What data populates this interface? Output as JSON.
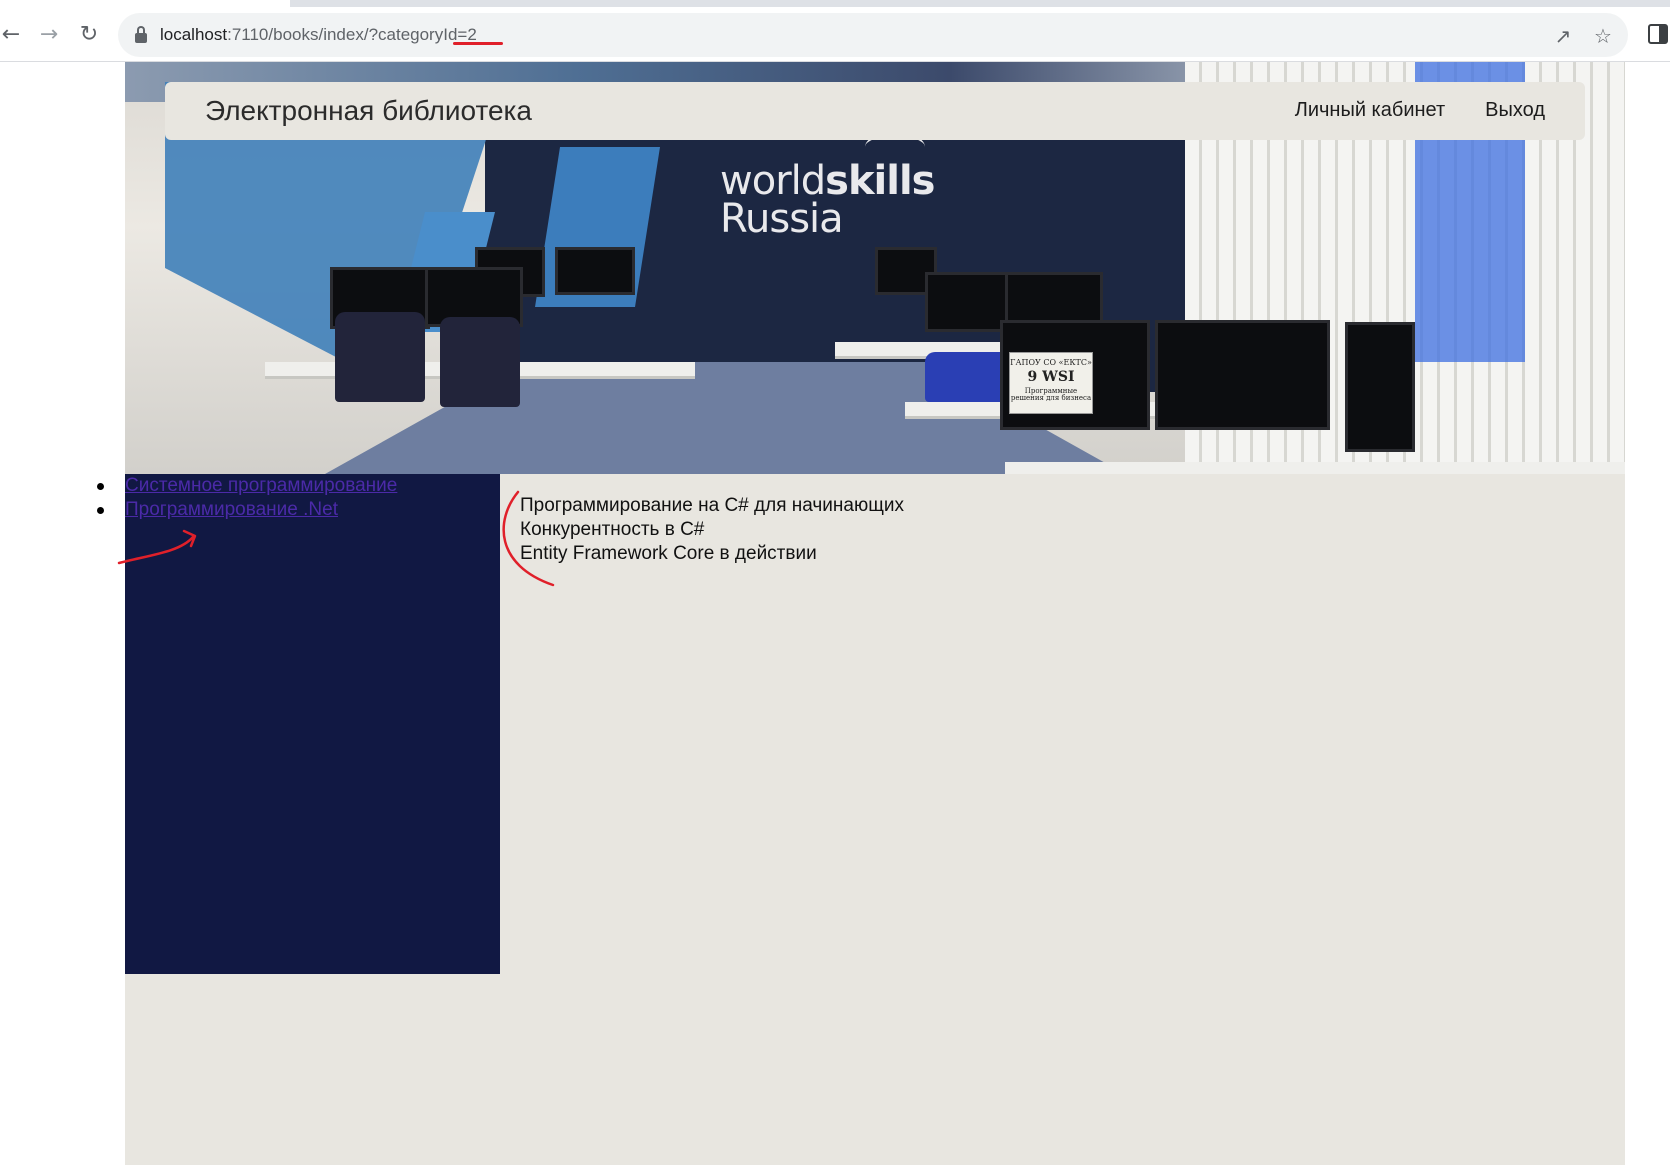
{
  "browser": {
    "url_host": "localhost",
    "url_rest": ":7110/books/index/?categoryId=2",
    "icons": {
      "back": "arrow-left-icon",
      "forward": "arrow-right-icon",
      "reload": "reload-icon",
      "lock": "lock-icon",
      "share": "share-icon",
      "bookmark": "star-icon",
      "side_panel": "side-panel-icon"
    }
  },
  "header": {
    "brand": "Электронная библиотека",
    "nav": [
      {
        "label": "Личный кабинет"
      },
      {
        "label": "Выход"
      }
    ]
  },
  "hero": {
    "logo_line1_a": "world",
    "logo_line1_b": "skills",
    "logo_line2": "Russia",
    "sign_line1": "ГАПОУ СО «ЕКТС»",
    "sign_line2": "9 WSI",
    "sign_line3": "Программные решения для бизнеса"
  },
  "categories": [
    {
      "label": "Системное программирование"
    },
    {
      "label": "Программирование .Net"
    }
  ],
  "books": [
    {
      "title": "Программирование на C# для начинающих"
    },
    {
      "title": "Конкурентность в C#"
    },
    {
      "title": "Entity Framework Core в действии"
    }
  ],
  "colors": {
    "page_bg": "#e8e6e0",
    "sidebar_bg": "#111843",
    "link": "#4b2aa8",
    "annotation": "#e0202a"
  }
}
